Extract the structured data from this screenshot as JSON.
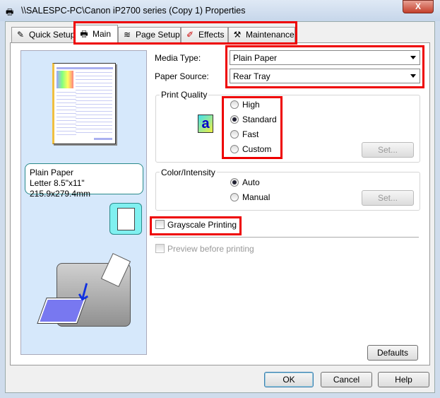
{
  "window": {
    "title": "\\\\SALESPC-PC\\Canon iP2700 series (Copy 1) Properties",
    "close_label": "X"
  },
  "tabs": [
    {
      "label": "Quick Setup",
      "icon": "quick-setup-icon"
    },
    {
      "label": "Main",
      "icon": "printer-icon",
      "active": true
    },
    {
      "label": "Page Setup",
      "icon": "page-stack-icon"
    },
    {
      "label": "Effects",
      "icon": "brush-icon"
    },
    {
      "label": "Maintenance",
      "icon": "tools-icon"
    }
  ],
  "preview": {
    "media_line": "Plain Paper",
    "size_line": "Letter 8.5\"x11\" 215.9x279.4mm"
  },
  "main": {
    "media_type_label": "Media Type:",
    "media_type_value": "Plain Paper",
    "paper_source_label": "Paper Source:",
    "paper_source_value": "Rear Tray",
    "print_quality": {
      "label": "Print Quality",
      "options": [
        "High",
        "Standard",
        "Fast",
        "Custom"
      ],
      "selected": "Standard",
      "set_label": "Set..."
    },
    "color_intensity": {
      "label": "Color/Intensity",
      "options": [
        "Auto",
        "Manual"
      ],
      "selected": "Auto",
      "set_label": "Set..."
    },
    "grayscale_label": "Grayscale Printing",
    "grayscale_checked": false,
    "preview_label": "Preview before printing",
    "preview_checked": false,
    "defaults_label": "Defaults"
  },
  "footer": {
    "ok": "OK",
    "cancel": "Cancel",
    "help": "Help"
  },
  "colors": {
    "highlight": "#e00000",
    "preview_bg": "#d6e8fb"
  }
}
